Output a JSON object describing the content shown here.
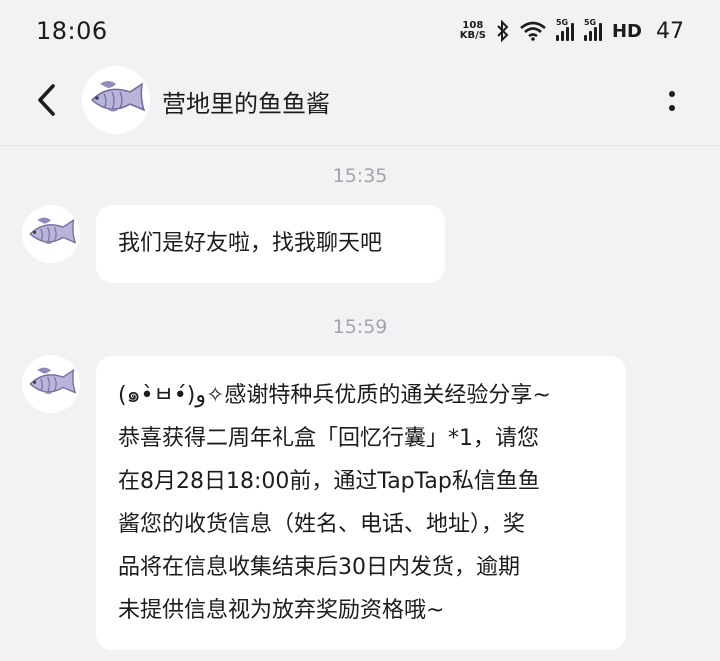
{
  "status_bar": {
    "time": "18:06",
    "net_speed_value": "108",
    "net_speed_unit": "KB/S",
    "signal_1_tag": "5G",
    "signal_2_tag": "5G",
    "hd_label": "HD",
    "battery": "47",
    "icons": [
      "bluetooth-icon",
      "wifi-icon",
      "signal-icon",
      "signal-icon"
    ]
  },
  "header": {
    "title": "营地里的鱼鱼酱",
    "back_icon": "back-arrow-icon",
    "more_icon": "more-vertical-icon",
    "avatar_icon": "fish-icon"
  },
  "messages": [
    {
      "timestamp": "15:35",
      "sender_avatar": "fish-icon",
      "lines": [
        "我们是好友啦，找我聊天吧"
      ]
    },
    {
      "timestamp": "15:59",
      "sender_avatar": "fish-icon",
      "lines": [
        "(๑•̀ㅂ•́)و✧感谢特种兵优质的通关经验分享~",
        "恭喜获得二周年礼盒「回忆行囊」*1，请您",
        "在8月28日18:00前，通过TapTap私信鱼鱼",
        "酱您的收货信息（姓名、电话、地址），奖",
        "品将在信息收集结束后30日内发货，逾期",
        "未提供信息视为放弃奖励资格哦~"
      ]
    }
  ],
  "colors": {
    "background": "#f2f2f4",
    "bubble": "#ffffff",
    "timestamp": "#a4a4aa",
    "fish": "#8f8ab8"
  }
}
